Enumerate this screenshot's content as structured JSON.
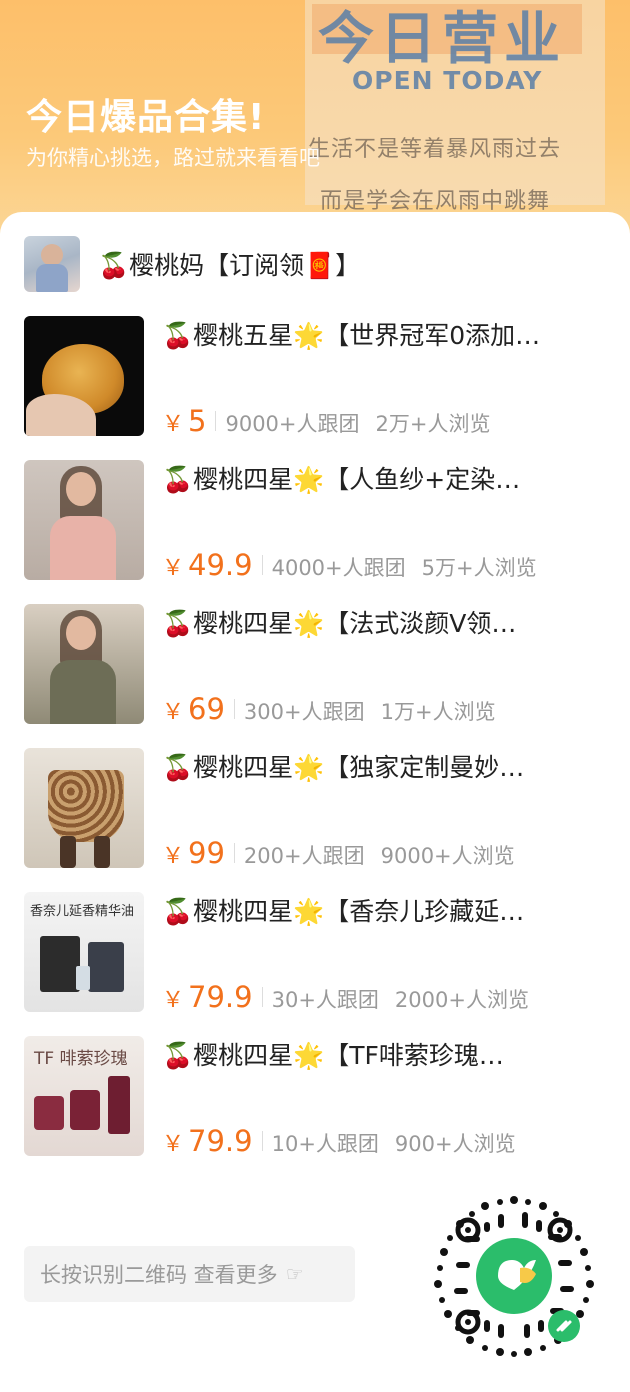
{
  "banner": {
    "open_title": "今日营业",
    "open_subtitle": "OPEN TODAY",
    "poem_line1": "生活不是等着暴风雨过去",
    "poem_line2": "而是学会在风雨中跳舞",
    "title": "今日爆品合集!",
    "subtitle": "为你精心挑选，路过就来看看吧"
  },
  "shop": {
    "name": "🍒樱桃妈【订阅领🧧】"
  },
  "items": [
    {
      "title": "🍒樱桃五星🌟【世界冠军0添加…",
      "currency": "￥",
      "price": "5",
      "followers": "9000+人跟团",
      "views": "2万+人浏览"
    },
    {
      "title": "🍒樱桃四星🌟【人鱼纱+定染…",
      "currency": "￥",
      "price": "49.9",
      "followers": "4000+人跟团",
      "views": "5万+人浏览"
    },
    {
      "title": "🍒樱桃四星🌟【法式淡颜V领…",
      "currency": "￥",
      "price": "69",
      "followers": "300+人跟团",
      "views": "1万+人浏览"
    },
    {
      "title": "🍒樱桃四星🌟【独家定制曼妙…",
      "currency": "￥",
      "price": "99",
      "followers": "200+人跟团",
      "views": "9000+人浏览"
    },
    {
      "title": "🍒樱桃四星🌟【香奈儿珍藏延…",
      "currency": "￥",
      "price": "79.9",
      "followers": "30+人跟团",
      "views": "2000+人浏览",
      "thumb_caption": "香奈儿延香精华油"
    },
    {
      "title": "🍒樱桃四星🌟【TF啡萦珍瑰…",
      "currency": "￥",
      "price": "79.9",
      "followers": "10+人跟团",
      "views": "900+人浏览",
      "thumb_caption": "TF 啡萦珍瑰"
    }
  ],
  "footer": {
    "more_label": "长按识别二维码 查看更多"
  },
  "colors": {
    "banner": "#fdbf6a",
    "price": "#f2711c",
    "qr_accent": "#2bbd6b"
  }
}
